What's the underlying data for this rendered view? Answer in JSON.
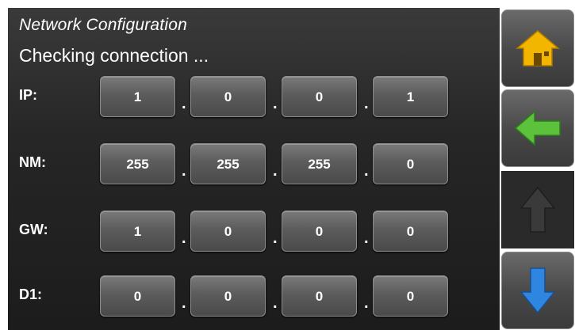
{
  "header": {
    "title": "Network Configuration",
    "status": "Checking connection ..."
  },
  "separator": ".",
  "rows": [
    {
      "label": "IP:",
      "octets": [
        "1",
        "0",
        "0",
        "1"
      ]
    },
    {
      "label": "NM:",
      "octets": [
        "255",
        "255",
        "255",
        "0"
      ]
    },
    {
      "label": "GW:",
      "octets": [
        "1",
        "0",
        "0",
        "0"
      ]
    },
    {
      "label": "D1:",
      "octets": [
        "0",
        "0",
        "0",
        "0"
      ]
    }
  ],
  "sidebar": {
    "buttons": [
      {
        "icon": "home-icon",
        "color": "#f0b400"
      },
      {
        "icon": "back-arrow-icon",
        "color": "#55b83a"
      },
      {
        "icon": "up-arrow-icon",
        "color": "#2c2c2c"
      },
      {
        "icon": "down-arrow-icon",
        "color": "#2f7fd8"
      }
    ]
  }
}
